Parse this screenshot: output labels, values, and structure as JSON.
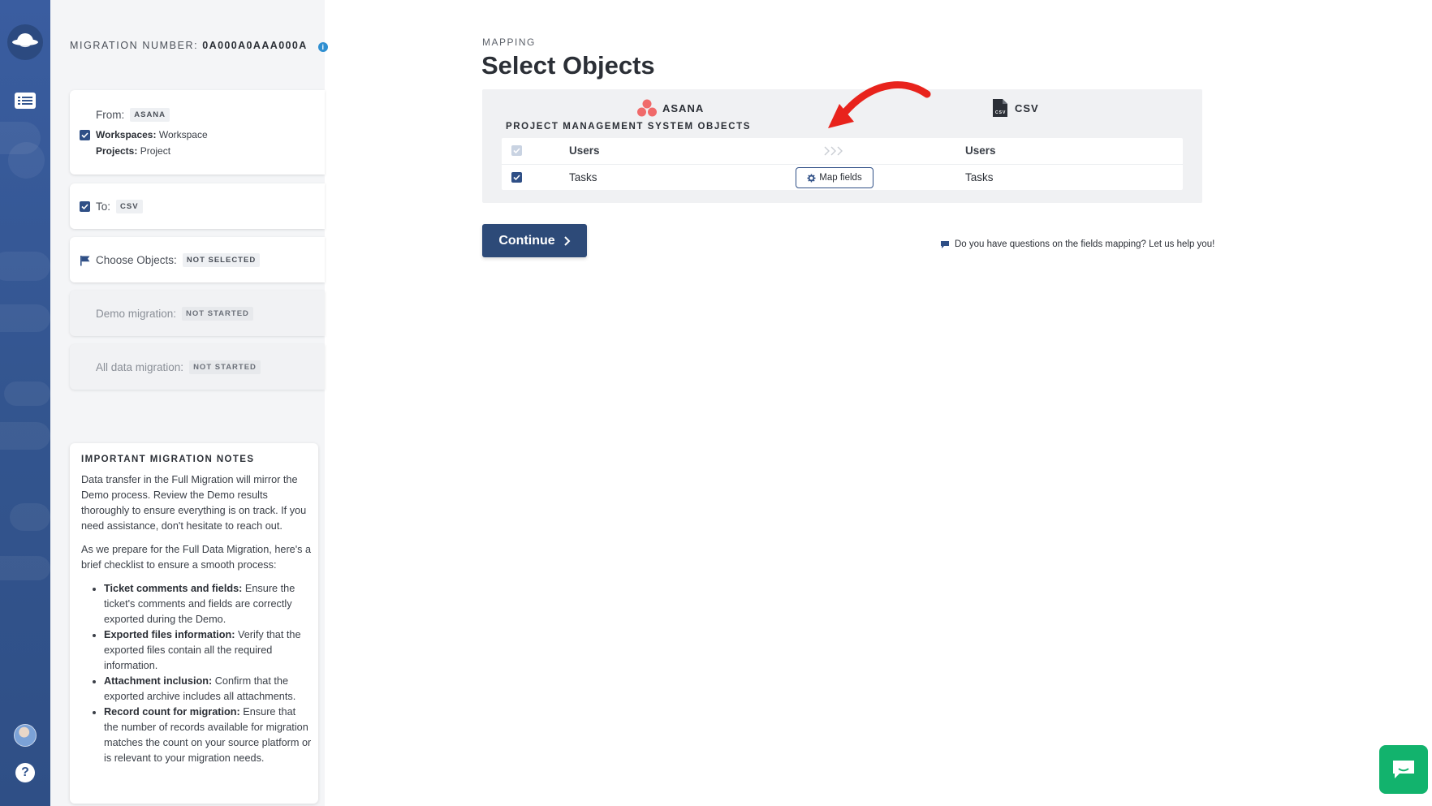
{
  "colors": {
    "rail": "#34568f",
    "primary": "#2d4a78",
    "accent_red": "#e8231c",
    "chat_green": "#12b36d",
    "info_blue": "#2f8fd1"
  },
  "icons": [
    "app-logo-icon",
    "list-icon",
    "avatar",
    "help-icon",
    "info-icon",
    "checkbox-icon",
    "flag-icon",
    "asana-logo-icon",
    "csv-file-icon",
    "gear-icon",
    "chevrons-right-icon",
    "chevron-right-icon",
    "comment-icon",
    "chat-icon",
    "red-arrow-annotation"
  ],
  "migration": {
    "label": "MIGRATION NUMBER:",
    "number": "0A000A0AAA000A"
  },
  "steps": {
    "from": {
      "label": "From:",
      "tag": "ASANA",
      "workspaces_label": "Workspaces:",
      "workspaces_value": "Workspace",
      "projects_label": "Projects:",
      "projects_value": "Project"
    },
    "to": {
      "label": "To:",
      "tag": "CSV"
    },
    "choose": {
      "label": "Choose Objects:",
      "tag": "NOT SELECTED"
    },
    "demo": {
      "label": "Demo migration:",
      "tag": "NOT STARTED"
    },
    "all": {
      "label": "All data migration:",
      "tag": "NOT STARTED"
    }
  },
  "notes": {
    "title": "IMPORTANT MIGRATION NOTES",
    "p1": "Data transfer in the Full Migration will mirror the Demo process. Review the Demo results thoroughly to ensure everything is on track. If you need assistance, don't hesitate to reach out.",
    "p2": "As we prepare for the Full Data Migration, here's a brief checklist to ensure a smooth process:",
    "items": [
      {
        "bold": "Ticket comments and fields:",
        "text": " Ensure the ticket's comments and fields are correctly exported during the Demo."
      },
      {
        "bold": "Exported files information:",
        "text": " Verify that the exported files contain all the required information."
      },
      {
        "bold": "Attachment inclusion:",
        "text": " Confirm that the exported archive includes all attachments."
      },
      {
        "bold": "Record count for migration:",
        "text": " Ensure that the number of records available for migration matches the count on your source platform or is relevant to your migration needs."
      }
    ]
  },
  "main": {
    "crumb": "MAPPING",
    "title": "Select Objects",
    "source": "ASANA",
    "target": "CSV",
    "section_label": "PROJECT MANAGEMENT SYSTEM OBJECTS",
    "rows": [
      {
        "source": "Users",
        "target": "Users"
      },
      {
        "source": "Tasks",
        "target": "Tasks",
        "action": "Map fields"
      }
    ],
    "continue": "Continue",
    "help": "Do you have questions on the fields mapping? Let us help you!"
  }
}
